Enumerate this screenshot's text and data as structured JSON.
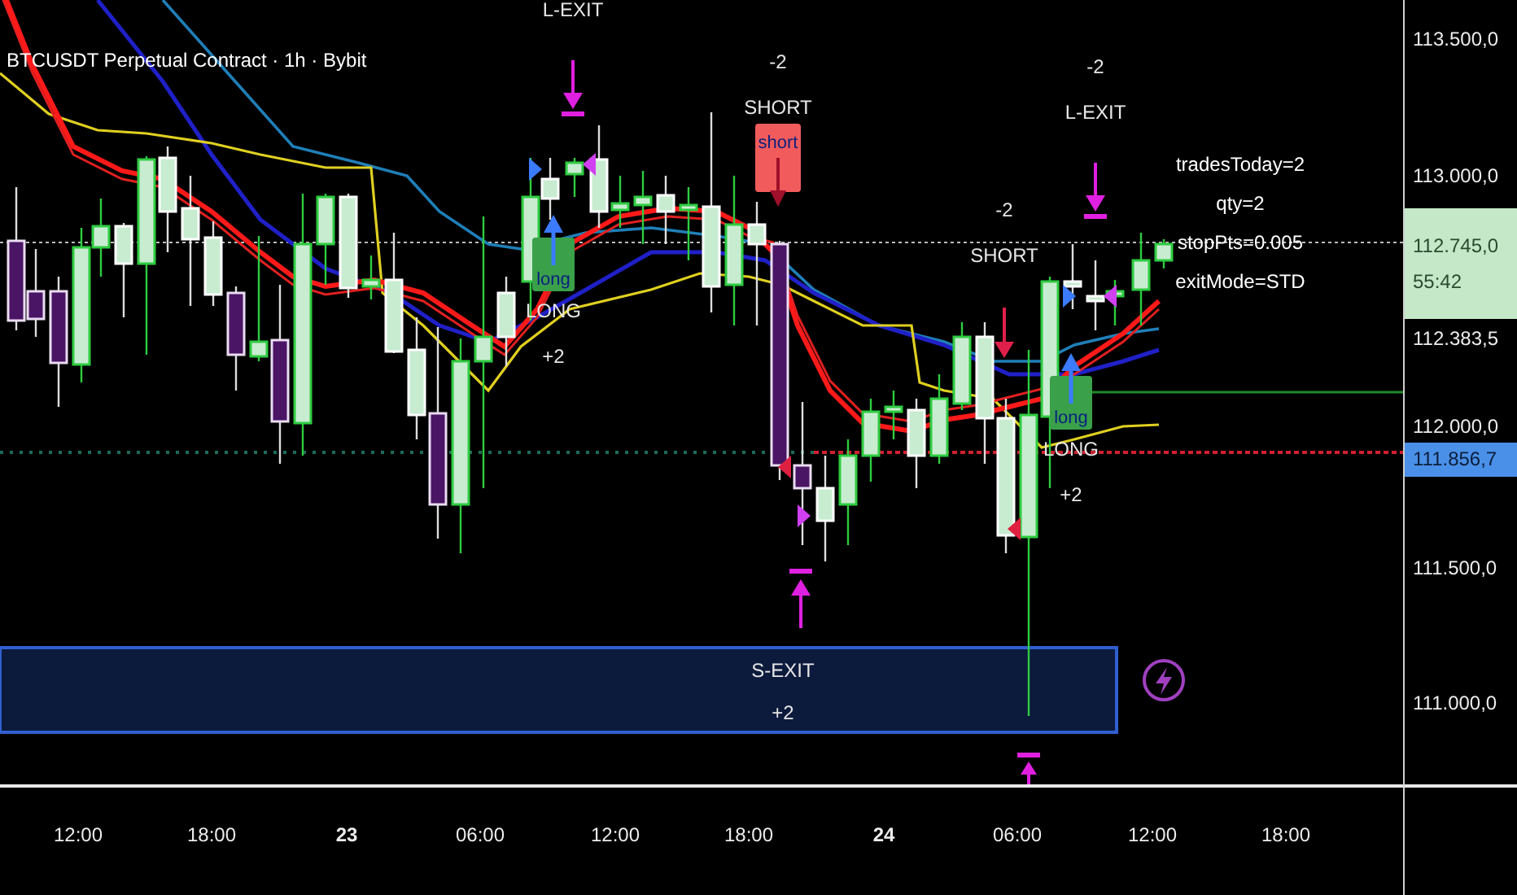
{
  "chart": {
    "title": "BTCUSDT Perpetual Contract · 1h · Bybit"
  },
  "signals": [
    {
      "kind": "exit",
      "lines": [
        "L-EXIT"
      ]
    },
    {
      "kind": "short",
      "lines": [
        "-2",
        "SHORT"
      ],
      "tag": "short"
    },
    {
      "kind": "long",
      "lines": [
        "LONG",
        "+2"
      ],
      "tag": "long"
    },
    {
      "kind": "short",
      "lines": [
        "-2",
        "SHORT"
      ]
    },
    {
      "kind": "exit",
      "lines": [
        "-2",
        "L-EXIT"
      ]
    },
    {
      "kind": "long",
      "lines": [
        "LONG",
        "+2"
      ],
      "tag": "long"
    }
  ],
  "exit_zone": {
    "lines": [
      "S-EXIT",
      "+2"
    ]
  },
  "info_lines": [
    "tradesToday=2",
    "qty=2",
    "stopPts=0.005",
    "exitMode=STD"
  ],
  "price_axis": {
    "ticks": [
      "113.500,0",
      "113.000,0",
      "112.383,5",
      "112.000,0",
      "111.500,0",
      "111.000,0"
    ],
    "last_price": {
      "value": "112.745,0",
      "countdown": "55:42"
    },
    "level_price": "111.856,7"
  },
  "time_axis": [
    {
      "label": "12:00",
      "kind": "time"
    },
    {
      "label": "18:00",
      "kind": "time"
    },
    {
      "label": "23",
      "kind": "day"
    },
    {
      "label": "06:00",
      "kind": "time"
    },
    {
      "label": "12:00",
      "kind": "time"
    },
    {
      "label": "18:00",
      "kind": "time"
    },
    {
      "label": "24",
      "kind": "day"
    },
    {
      "label": "06:00",
      "kind": "time"
    },
    {
      "label": "12:00",
      "kind": "time"
    },
    {
      "label": "18:00",
      "kind": "time"
    }
  ]
}
